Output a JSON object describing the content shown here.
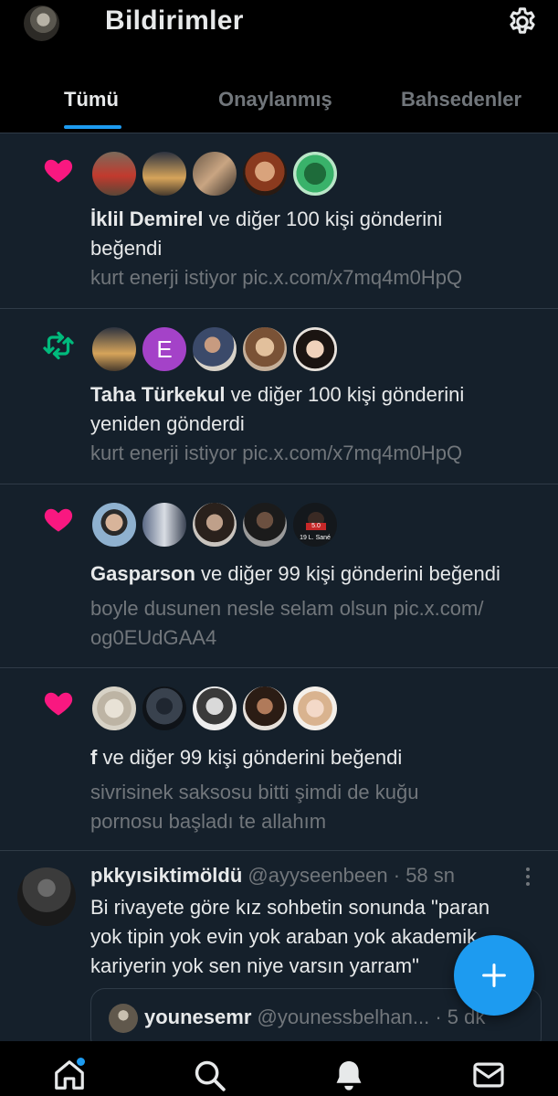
{
  "header": {
    "title": "Bildirimler",
    "avatar_icon": "profile-avatar",
    "settings_icon": "gear-icon"
  },
  "tabs": [
    {
      "label": "Tümü",
      "active": true
    },
    {
      "label": "Onaylanmış",
      "active": false
    },
    {
      "label": "Bahsedenler",
      "active": false
    }
  ],
  "notifications": [
    {
      "type": "like",
      "icon": "heart-icon",
      "actor": "İklil Demirel",
      "action_line1": " ve diğer 100 kişi gönderini",
      "action_line2": "beğendi",
      "preview": "kurt enerji istiyor pic.x.com/x7mq4m0HpQ"
    },
    {
      "type": "repost",
      "icon": "repost-icon",
      "actor": "Taha Türkekul",
      "action_line1": " ve diğer 100 kişi gönderini",
      "action_line2": "yeniden gönderdi",
      "avatar_letter": "E",
      "preview": "kurt enerji istiyor pic.x.com/x7mq4m0HpQ"
    },
    {
      "type": "like",
      "icon": "heart-icon",
      "actor": "Gasparson",
      "action_line1": " ve diğer 99 kişi gönderini beğendi",
      "avatar_badge_number": "5.0",
      "avatar_badge_text": "19 L. Sané",
      "preview_line1": "boyle dusunen nesle selam olsun pic.x.com/",
      "preview_line2": "og0EUdGAA4"
    },
    {
      "type": "like",
      "icon": "heart-icon",
      "actor": "f",
      "action_line1": " ve diğer 99 kişi gönderini beğendi",
      "preview_line1": "sivrisinek saksosu bitti şimdi de kuğu",
      "preview_line2": "pornosu başladı te allahım"
    }
  ],
  "post": {
    "name": "pkkyısiktimöldü",
    "handle": "@ayyseenbeen",
    "separator": " · ",
    "time": "58 sn",
    "body_line1": "Bi rivayete göre kız sohbetin sonunda \"paran",
    "body_line2": "yok tipin yok evin yok araban yok akademik",
    "body_line3": "kariyerin yok sen niye varsın yarram\"",
    "quote": {
      "name": "younesemr",
      "handle": "@youness​belhan...",
      "time": "· 5 dk"
    }
  },
  "fab_icon": "plus-icon",
  "bottom_nav": [
    {
      "icon": "home-icon",
      "has_dot": true
    },
    {
      "icon": "search-icon"
    },
    {
      "icon": "bell-icon",
      "active": true
    },
    {
      "icon": "mail-icon"
    }
  ],
  "colors": {
    "background": "#15202b",
    "accent": "#1d9bf0",
    "like": "#f91880",
    "repost": "#00ba7c",
    "muted": "#71767b"
  }
}
